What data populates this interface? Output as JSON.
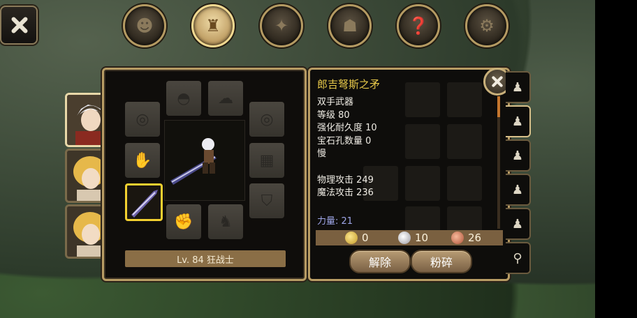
{
  "top_tabs": [
    {
      "icon": "head-icon",
      "glyph": "☻"
    },
    {
      "icon": "bag-icon",
      "glyph": "♜",
      "active": true
    },
    {
      "icon": "sword-compass-icon",
      "glyph": "✦"
    },
    {
      "icon": "party-icon",
      "glyph": "☗"
    },
    {
      "icon": "scroll-icon",
      "glyph": "❓"
    },
    {
      "icon": "gear-icon",
      "glyph": "⚙"
    }
  ],
  "character": {
    "level_label": "Lv. 84 狂战士"
  },
  "item": {
    "name": "郎吉弩斯之矛",
    "stats": [
      "双手武器",
      "等级 80",
      "强化耐久度 10",
      "宝石孔数量 0",
      "慢",
      "",
      "物理攻击 249",
      "魔法攻击 236"
    ],
    "power": "力量: 21"
  },
  "currency": {
    "gold": "0",
    "silver": "10",
    "copper": "26"
  },
  "buttons": {
    "unequip": "解除",
    "smash": "粉碎"
  },
  "colors": {
    "title": "#e8c94a",
    "power": "#9fa6e8",
    "frame": "#b89c64",
    "selected_slot": "#f2d030"
  }
}
